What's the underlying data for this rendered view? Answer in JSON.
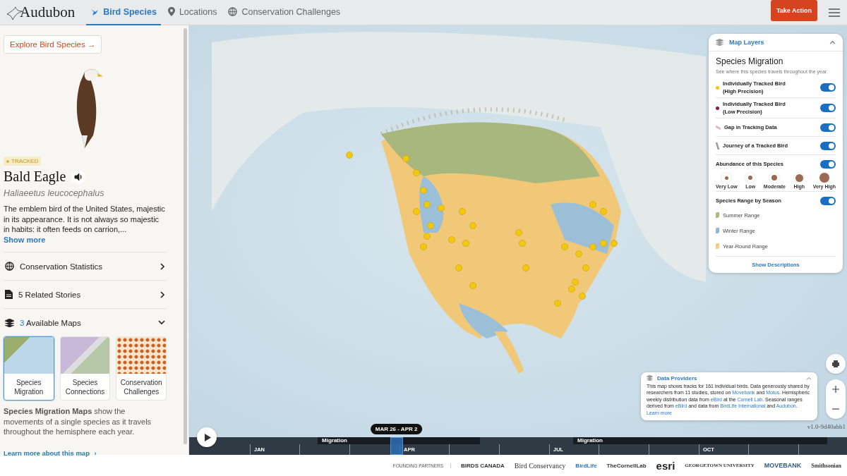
{
  "header": {
    "logo": "Audubon",
    "tabs": [
      {
        "label": "Bird Species",
        "selected": true
      },
      {
        "label": "Locations",
        "selected": false
      },
      {
        "label": "Conservation Challenges",
        "selected": false
      }
    ],
    "action": "Take Action"
  },
  "sidebar": {
    "explore": "Explore Bird Species",
    "explore_arrow": "→",
    "badge": "TRACKED",
    "name": "Bald Eagle",
    "latin": "Haliaeetus leucocephalus",
    "description": "The emblem bird of the United States, majestic in its appearance. It is not always so majestic in habits: it often feeds on carrion,...",
    "more": "Show more",
    "sections": [
      {
        "label": "Conservation Statistics",
        "expanded": false
      },
      {
        "label": "5 Related Stories",
        "expanded": false
      },
      {
        "count": "3",
        "label": "Available Maps",
        "expanded": true
      }
    ],
    "maps": [
      {
        "label": "Species Migration",
        "kind": "migration",
        "selected": true
      },
      {
        "label": "Species Connections",
        "kind": "connections",
        "selected": false
      },
      {
        "label": "Conservation Challenges",
        "kind": "challenges",
        "selected": false
      }
    ],
    "map_info": "**Species Migration Maps** show the movements of a single species as it travels throughout the hemisphere each year.",
    "learn": "Learn more about this map",
    "learn_arrow": "›"
  },
  "layers": {
    "title": "Map Layers",
    "expanded": true,
    "heading": "Species Migration",
    "subtitle": "See where this species travels throughout the year.",
    "items": [
      {
        "kind": "point",
        "label": "Individually Tracked Bird (High Precision)",
        "color": "#f2c811",
        "on": true
      },
      {
        "kind": "point",
        "label": "Individually Tracked Bird (Low Precision)",
        "color": "#7a1f4a",
        "on": true
      },
      {
        "kind": "gap",
        "label": "Gap in Tracking Data",
        "on": true
      },
      {
        "kind": "journey",
        "label": "Journey of a Tracked Bird",
        "on": true
      },
      {
        "kind": "abundance",
        "label": "Abundance of this Species",
        "on": true,
        "levels": [
          "Very Low",
          "Low",
          "Moderate",
          "High",
          "Very High"
        ]
      },
      {
        "kind": "ranges",
        "label": "Species Range by Season",
        "on": true,
        "ranges": [
          {
            "label": "Summer Range",
            "color": "#a9bd7a"
          },
          {
            "label": "Winter Range",
            "color": "#8fb6d2"
          },
          {
            "label": "Year-Round Range",
            "color": "#f2cf7c"
          }
        ]
      }
    ],
    "show": "Show Descriptions"
  },
  "providers": {
    "title": "Data Providers",
    "expanded": true,
    "segments": [
      {
        "text": "This map shows tracks for 161 individual birds. Data generously shared by researchers from 11 studies, stored on ",
        "link": false
      },
      {
        "text": "Movebank",
        "link": true
      },
      {
        "text": " and ",
        "link": false
      },
      {
        "text": "Motus",
        "link": true
      },
      {
        "text": ". Hemispheric weekly distribution data from ",
        "link": false
      },
      {
        "text": "eBird",
        "link": true
      },
      {
        "text": " at the ",
        "link": false
      },
      {
        "text": "Cornell Lab",
        "link": true
      },
      {
        "text": ". Seasonal ranges derived from ",
        "link": false
      },
      {
        "text": "eBird",
        "link": true
      },
      {
        "text": " and data from ",
        "link": false
      },
      {
        "text": "BirdLife International",
        "link": true
      },
      {
        "text": " and ",
        "link": false
      },
      {
        "text": "Audubon",
        "link": true
      },
      {
        "text": ". ",
        "link": false
      },
      {
        "text": "Learn more",
        "link": true
      }
    ]
  },
  "version": "v1.0-9d40abb1",
  "timeline": {
    "range": "MAR 26 - APR 2",
    "level": 0.315,
    "months": [
      "JAN",
      "APR",
      "JUL",
      "OCT"
    ],
    "bands": [
      "Migration",
      "Migration"
    ]
  },
  "footer": {
    "label": "FOUNDING PARTNERS",
    "partners": [
      "BIRDS CANADA",
      "Bird Conservancy",
      "BirdLife",
      "TheCornellLab",
      "esri",
      "GEORGETOWN UNIVERSITY",
      "MOVEBANK",
      "Smithsonian"
    ]
  }
}
